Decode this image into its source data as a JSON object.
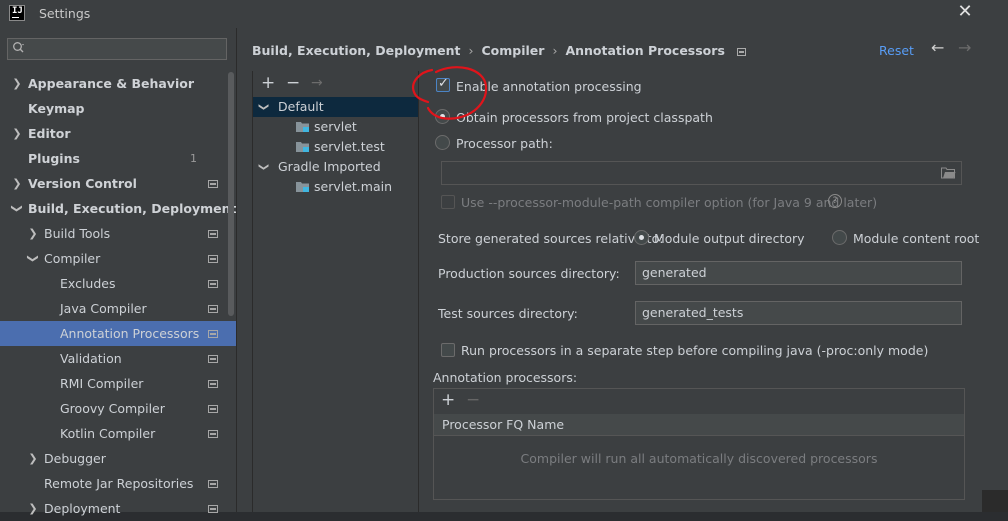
{
  "window": {
    "title": "Settings"
  },
  "search": {
    "placeholder": "",
    "value": ""
  },
  "sidebar": {
    "items": [
      {
        "label": "Appearance & Behavior",
        "expanded": false
      },
      {
        "label": "Keymap"
      },
      {
        "label": "Editor",
        "expanded": false
      },
      {
        "label": "Plugins",
        "badge": "1"
      },
      {
        "label": "Version Control",
        "expanded": false
      },
      {
        "label": "Build, Execution, Deployment",
        "expanded": true
      },
      {
        "label": "Build Tools",
        "expanded": false
      },
      {
        "label": "Compiler",
        "expanded": true
      },
      {
        "label": "Excludes"
      },
      {
        "label": "Java Compiler"
      },
      {
        "label": "Annotation Processors",
        "selected": true
      },
      {
        "label": "Validation"
      },
      {
        "label": "RMI Compiler"
      },
      {
        "label": "Groovy Compiler"
      },
      {
        "label": "Kotlin Compiler"
      },
      {
        "label": "Debugger",
        "expanded": false
      },
      {
        "label": "Remote Jar Repositories"
      },
      {
        "label": "Deployment",
        "expanded": false
      }
    ]
  },
  "header": {
    "breadcrumb": [
      "Build, Execution, Deployment",
      "Compiler",
      "Annotation Processors"
    ],
    "reset_label": "Reset"
  },
  "modules": {
    "items": [
      {
        "label": "Default",
        "level": 0,
        "selected": true
      },
      {
        "label": "servlet",
        "level": 1
      },
      {
        "label": "servlet.test",
        "level": 1
      },
      {
        "label": "Gradle Imported",
        "level": 0
      },
      {
        "label": "servlet.main",
        "level": 1
      }
    ]
  },
  "form": {
    "enable_label": "Enable annotation processing",
    "enable_checked": true,
    "obtain_label": "Obtain processors from project classpath",
    "processor_path_label": "Processor path:",
    "processor_path_value": "",
    "module_path_label": "Use --processor-module-path compiler option (for Java 9 and later)",
    "store_label": "Store generated sources relative to:",
    "module_output_label": "Module output directory",
    "module_content_label": "Module content root",
    "production_label": "Production sources directory:",
    "production_value": "generated",
    "test_label": "Test sources directory:",
    "test_value": "generated_tests",
    "separate_step_label": "Run processors in a separate step before compiling java (-proc:only mode)",
    "annotation_processors_label": "Annotation processors:",
    "table_header": "Processor FQ Name",
    "table_empty": "Compiler will run all automatically discovered processors"
  },
  "colors": {
    "selection": "#4b6eaf",
    "link": "#589df6",
    "annotation_circle": "#e0141b"
  }
}
